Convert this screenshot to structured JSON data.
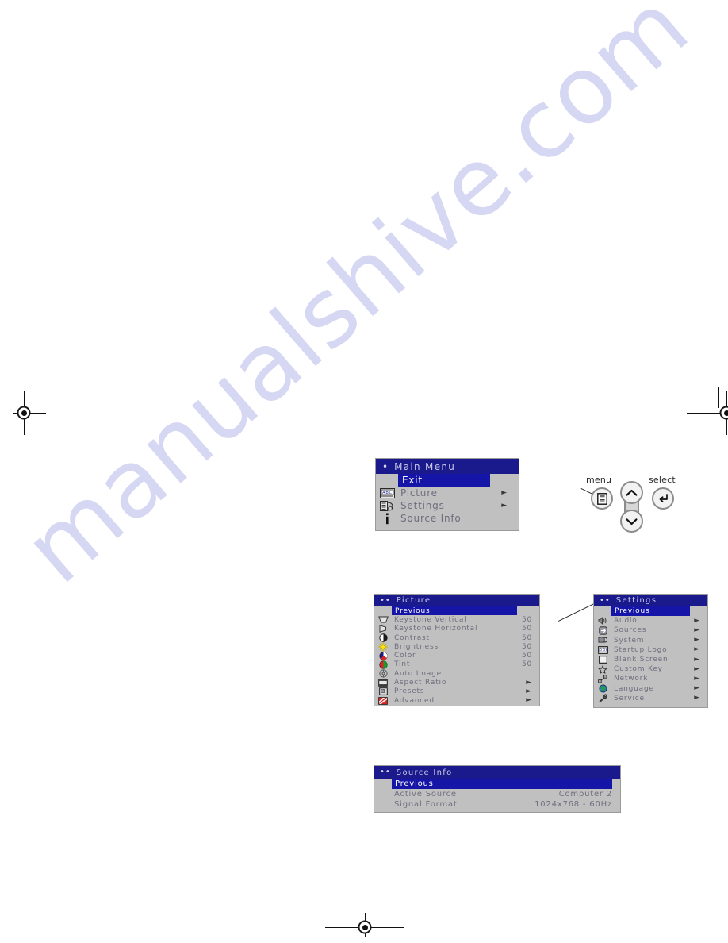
{
  "page": {
    "watermark_text": "manualshive.com",
    "background_color": "#ffffff"
  },
  "theme": {
    "osd_background": "#c0c0c0",
    "osd_titlebar": "#1a1a8c",
    "osd_highlight": "#1515a8",
    "osd_text": "#6e6e7e",
    "osd_title_text": "#c9c9e8"
  },
  "main_menu": {
    "title": "Main Menu",
    "title_bullets": "•",
    "items": [
      {
        "label": "Exit",
        "icon": "none-icon",
        "selected": true,
        "arrow": ""
      },
      {
        "label": "Picture",
        "icon": "picture-abc-icon",
        "selected": false,
        "arrow": "►"
      },
      {
        "label": "Settings",
        "icon": "settings-slider-icon",
        "selected": false,
        "arrow": "►"
      },
      {
        "label": "Source Info",
        "icon": "info-i-icon",
        "selected": false,
        "arrow": ""
      }
    ]
  },
  "picture_menu": {
    "title": "Picture",
    "title_bullets": "••",
    "items": [
      {
        "label": "Previous",
        "icon": "none-icon",
        "selected": true,
        "value": "",
        "arrow": ""
      },
      {
        "label": "Keystone Vertical",
        "icon": "keystone-vertical-icon",
        "selected": false,
        "value": "50",
        "arrow": ""
      },
      {
        "label": "Keystone Horizontal",
        "icon": "keystone-horizontal-icon",
        "selected": false,
        "value": "50",
        "arrow": ""
      },
      {
        "label": "Contrast",
        "icon": "contrast-icon",
        "selected": false,
        "value": "50",
        "arrow": ""
      },
      {
        "label": "Brightness",
        "icon": "brightness-sun-icon",
        "selected": false,
        "value": "50",
        "arrow": ""
      },
      {
        "label": "Color",
        "icon": "color-wheel-icon",
        "selected": false,
        "value": "50",
        "arrow": ""
      },
      {
        "label": "Tint",
        "icon": "tint-icon",
        "selected": false,
        "value": "50",
        "arrow": ""
      },
      {
        "label": "Auto Image",
        "icon": "auto-image-icon",
        "selected": false,
        "value": "",
        "arrow": ""
      },
      {
        "label": "Aspect Ratio",
        "icon": "aspect-ratio-icon",
        "selected": false,
        "value": "",
        "arrow": "►"
      },
      {
        "label": "Presets",
        "icon": "presets-icon",
        "selected": false,
        "value": "",
        "arrow": "►"
      },
      {
        "label": "Advanced",
        "icon": "advanced-icon",
        "selected": false,
        "value": "",
        "arrow": "►"
      }
    ]
  },
  "settings_menu": {
    "title": "Settings",
    "title_bullets": "••",
    "items": [
      {
        "label": "Previous",
        "icon": "none-icon",
        "selected": true,
        "arrow": ""
      },
      {
        "label": "Audio",
        "icon": "speaker-icon",
        "selected": false,
        "arrow": "►"
      },
      {
        "label": "Sources",
        "icon": "sources-arrow-icon",
        "selected": false,
        "arrow": "►"
      },
      {
        "label": "System",
        "icon": "system-icon",
        "selected": false,
        "arrow": "►"
      },
      {
        "label": "Startup Logo",
        "icon": "startup-logo-icon",
        "selected": false,
        "arrow": "►"
      },
      {
        "label": "Blank Screen",
        "icon": "blank-screen-icon",
        "selected": false,
        "arrow": "►"
      },
      {
        "label": "Custom Key",
        "icon": "star-icon",
        "selected": false,
        "arrow": "►"
      },
      {
        "label": "Network",
        "icon": "network-icon",
        "selected": false,
        "arrow": "►"
      },
      {
        "label": "Language",
        "icon": "globe-icon",
        "selected": false,
        "arrow": "►"
      },
      {
        "label": "Service",
        "icon": "wrench-icon",
        "selected": false,
        "arrow": "►"
      }
    ]
  },
  "source_info_menu": {
    "title": "Source Info",
    "title_bullets": "••",
    "items": [
      {
        "label": "Previous",
        "selected": true,
        "value": ""
      },
      {
        "label": "Active Source",
        "selected": false,
        "value": "Computer 2"
      },
      {
        "label": "Signal Format",
        "selected": false,
        "value": "1024x768 - 60Hz"
      }
    ]
  },
  "keypad": {
    "menu_label": "menu",
    "select_label": "select",
    "up_icon": "chevron-up-icon",
    "down_icon": "chevron-down-icon",
    "menu_icon": "menu-list-icon",
    "select_icon": "enter-return-icon"
  }
}
